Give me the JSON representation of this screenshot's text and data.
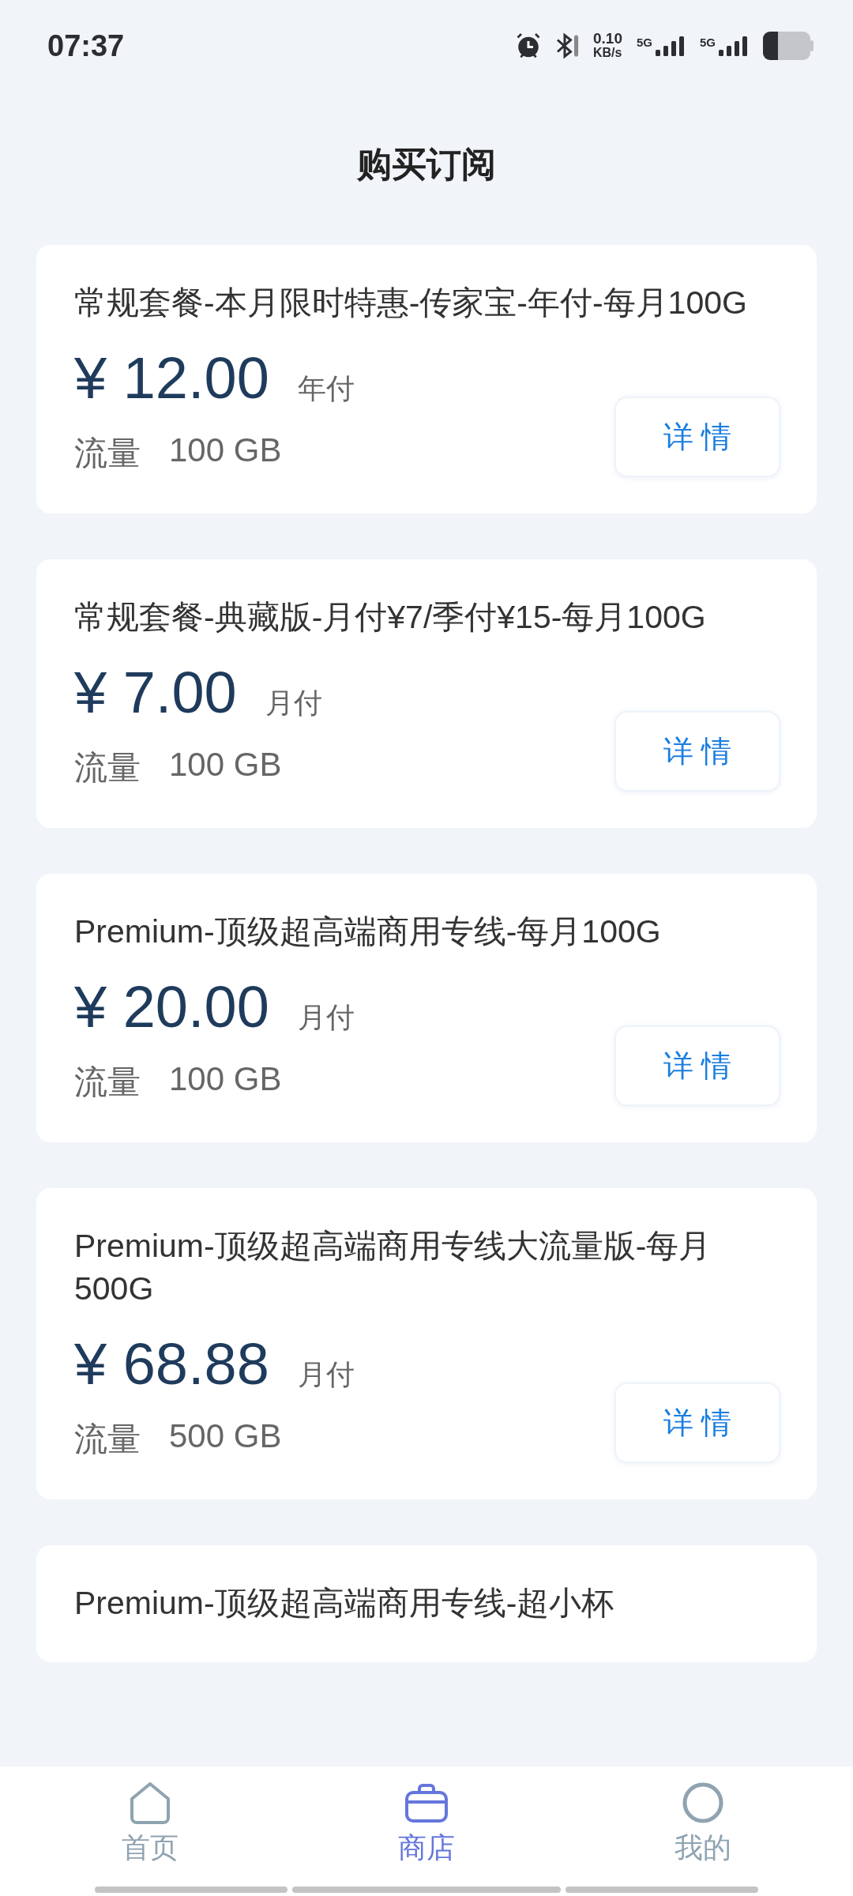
{
  "status_bar": {
    "time": "07:37",
    "net_speed": "0.10",
    "net_unit": "KB/s",
    "networks": [
      "5G",
      "5G"
    ]
  },
  "header": {
    "title": "购买订阅"
  },
  "plans": [
    {
      "name": "常规套餐-本月限时特惠-传家宝-年付-每月100G",
      "price": "¥ 12.00",
      "period": "年付",
      "traffic_label": "流量",
      "traffic": "100 GB",
      "button": "详 情"
    },
    {
      "name": "常规套餐-典藏版-月付¥7/季付¥15-每月100G",
      "price": "¥ 7.00",
      "period": "月付",
      "traffic_label": "流量",
      "traffic": "100 GB",
      "button": "详 情"
    },
    {
      "name": "Premium-顶级超高端商用专线-每月100G",
      "price": "¥ 20.00",
      "period": "月付",
      "traffic_label": "流量",
      "traffic": "100 GB",
      "button": "详 情"
    },
    {
      "name": "Premium-顶级超高端商用专线大流量版-每月500G",
      "price": "¥ 68.88",
      "period": "月付",
      "traffic_label": "流量",
      "traffic": "500 GB",
      "button": "详 情"
    },
    {
      "name": "Premium-顶级超高端商用专线-超小杯"
    }
  ],
  "bottom_nav": [
    {
      "label": "首页",
      "kind": "home",
      "selected": false
    },
    {
      "label": "商店",
      "kind": "shop",
      "selected": true
    },
    {
      "label": "我的",
      "kind": "profile",
      "selected": false
    }
  ]
}
